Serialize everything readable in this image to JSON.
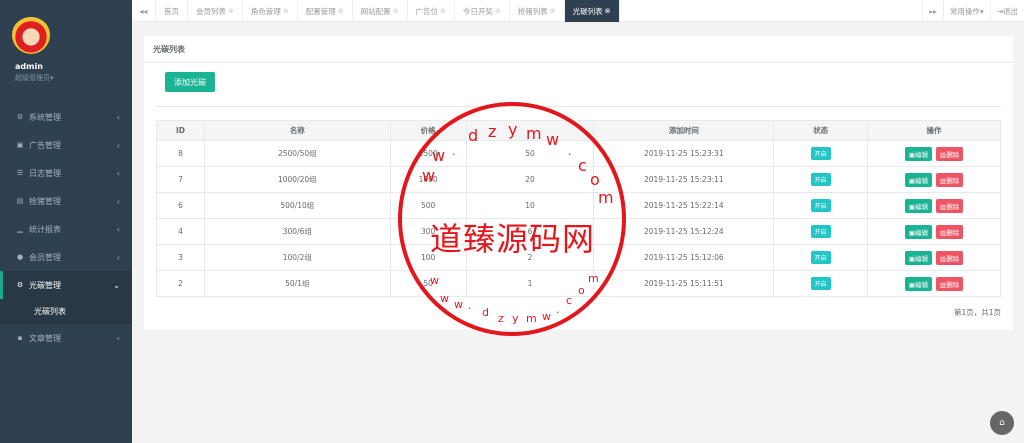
{
  "sidebar": {
    "username": "admin",
    "role": "超级管理员",
    "menu": [
      {
        "label": "系统管理",
        "icon": "gear-icon",
        "glyph": "⚙"
      },
      {
        "label": "广告管理",
        "icon": "image-icon",
        "glyph": "▣"
      },
      {
        "label": "日志管理",
        "icon": "list-icon",
        "glyph": "☰"
      },
      {
        "label": "抢猪管理",
        "icon": "book-icon",
        "glyph": "▤"
      },
      {
        "label": "统计报表",
        "icon": "bar-chart-icon",
        "glyph": "▁"
      },
      {
        "label": "会员管理",
        "icon": "user-icon",
        "glyph": "●"
      },
      {
        "label": "光碳管理",
        "icon": "gear-icon",
        "glyph": "⚙"
      },
      {
        "label": "文章管理",
        "icon": "file-icon",
        "glyph": "▪"
      }
    ],
    "submenu_label": "光碳列表"
  },
  "topbar": {
    "tabs": [
      {
        "label": "首页",
        "closable": false
      },
      {
        "label": "会员列表",
        "closable": true
      },
      {
        "label": "角色管理",
        "closable": true
      },
      {
        "label": "配置管理",
        "closable": true
      },
      {
        "label": "网站配置",
        "closable": true
      },
      {
        "label": "广告位",
        "closable": true
      },
      {
        "label": "今日开奖",
        "closable": true
      },
      {
        "label": "抢猪列表",
        "closable": true
      },
      {
        "label": "光碳列表",
        "closable": true,
        "active": true
      }
    ],
    "quick_ops": "常用操作",
    "logout": "退出"
  },
  "panel": {
    "title": "光碳列表",
    "add_button": "添加光碳",
    "columns": [
      "ID",
      "名称",
      "价格",
      "",
      "添加时间",
      "状态",
      "操作"
    ],
    "rows": [
      {
        "id": "8",
        "name": "2500/50组",
        "price": "2500",
        "qty": "50",
        "time": "2019-11-25 15:23:31",
        "status": "开启"
      },
      {
        "id": "7",
        "name": "1000/20组",
        "price": "1000",
        "qty": "20",
        "time": "2019-11-25 15:23:11",
        "status": "开启"
      },
      {
        "id": "6",
        "name": "500/10组",
        "price": "500",
        "qty": "10",
        "time": "2019-11-25 15:22:14",
        "status": "开启"
      },
      {
        "id": "4",
        "name": "300/6组",
        "price": "300",
        "qty": "6",
        "time": "2019-11-25 15:12:24",
        "status": "开启"
      },
      {
        "id": "3",
        "name": "100/2组",
        "price": "100",
        "qty": "2",
        "time": "2019-11-25 15:12:06",
        "status": "开启"
      },
      {
        "id": "2",
        "name": "50/1组",
        "price": "50",
        "qty": "1",
        "time": "2019-11-25 15:11:51",
        "status": "开启"
      }
    ],
    "edit_label": "编辑",
    "delete_label": "删除",
    "pagination": "第1页，共1页"
  },
  "watermark": {
    "center_text": "道臻源码网",
    "ring_top": "ww.dzym.com",
    "ring_bottom": "ww.dzym.com"
  },
  "colors": {
    "sidebar": "#2f4050",
    "primary": "#1ab394",
    "danger": "#ed5565",
    "info": "#23c6c8",
    "stamp": "#e3171b"
  }
}
